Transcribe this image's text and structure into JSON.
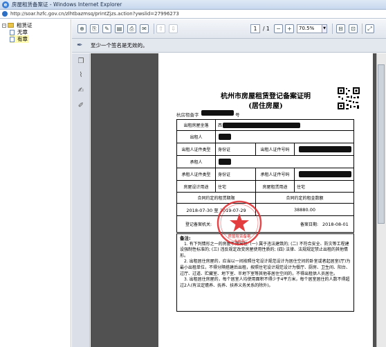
{
  "window": {
    "title": "房屋租赁备案证 - Windows Internet Explorer",
    "url": "http://soar.hzfc.gov.cn/zlhtbazmsq/printZjzs.action?ywslid=27996273"
  },
  "tree": {
    "root_label": "租赁证",
    "items": [
      {
        "label": "无章",
        "selected": false
      },
      {
        "label": "有章",
        "selected": true
      }
    ]
  },
  "toolbar": {
    "page_current": "1",
    "page_total": "/ 1",
    "zoom": "70.5%"
  },
  "signature_bar": {
    "message": "至少一个签名是无效的。"
  },
  "certificate": {
    "title": "杭州市房屋租赁登记备案证明",
    "subtitle": "(居住房屋)",
    "number_prefix": "杭房租备字",
    "number_suffix": "号",
    "rows": {
      "address_label": "出租房屋坐落",
      "address_value": "西",
      "lessor_label": "出租人",
      "lessor_id_type_label": "出租人证件类型",
      "lessor_id_type_value": "身份证",
      "lessor_id_no_label": "出租人证件号码",
      "lessee_label": "承租人",
      "lessee_id_type_label": "承租人证件类型",
      "lessee_id_type_value": "身份证",
      "lessee_id_no_label": "承租人证件号码",
      "design_use_label": "房屋设计用途",
      "design_use_value": "住宅",
      "rental_use_label": "房屋租赁用途",
      "rental_use_value": "住宅",
      "term_label": "合同约定的租赁期限",
      "amount_label": "合同约定的租金数额",
      "term_value": "2018-07-30 至 2019-07-29",
      "amount_value": "38880.00",
      "reg_org_label": "登记备案机关:",
      "reg_date_label": "备案日期:",
      "reg_date_value": "2018-08-01"
    },
    "notes": {
      "heading": "备注:",
      "items": [
        "1. 有下列情形之一的房屋不得出租: (一) 属于违法建筑的; (二) 不符合安全、防灾等工程建设强制性标准的; (三) 违反规定改变房屋使用性质的; (四) 法律、法规规定禁止出租的其他情形。",
        "2. 出租居住房屋的，应当以一间按照住宅设计规范设计为居住空间的卧室或者起居室(厅)为最小出租单位，不得分隔搭建后出租，按照住宅设计规范设计为餐厅、厨房、卫生间、阳台、过厅、过道、贮藏室、地下室、半地下室等其他非居住空间的，不得出租供人员居住。",
        "3. 出租居住房屋的，每个居室人均使用面积不得少于4平方米，每个居室居住的人数不得超过2人(有法定赡养、抚养、扶养义务关系的除外)。"
      ]
    },
    "stamp_text": "房屋租赁备案 专用章"
  },
  "colors": {
    "stamp_red": "#e0282b",
    "viewer_bg": "#515151",
    "selection_yellow": "#fffbb0"
  }
}
